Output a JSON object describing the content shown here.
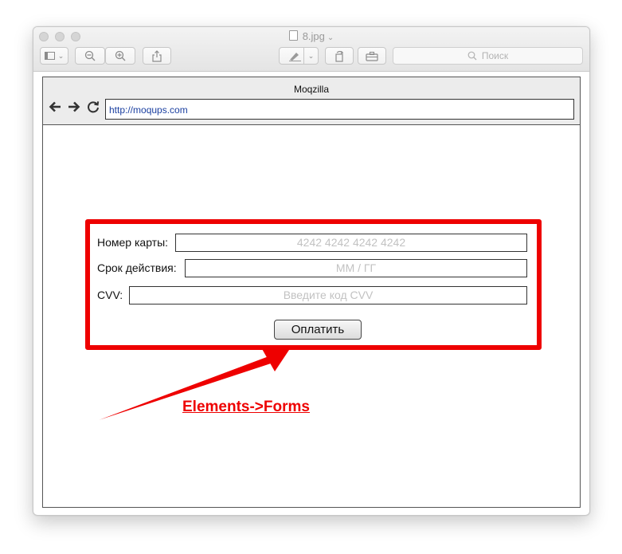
{
  "window": {
    "title": "8.jpg",
    "search_placeholder": "Поиск",
    "colors": {
      "chrome": "#e9e9e9",
      "traffic_light": "#d5d5d5"
    },
    "toolbar_icons": [
      "sidebar-icon",
      "zoom-out-icon",
      "zoom-in-icon",
      "share-icon",
      "markup-icon",
      "rotate-icon",
      "toolbox-icon"
    ]
  },
  "mockup": {
    "browser_title": "Moqzilla",
    "url": "http://moqups.com",
    "nav_icons": [
      "back-arrow-icon",
      "forward-arrow-icon",
      "reload-icon"
    ]
  },
  "form": {
    "card_label": "Номер карты:",
    "card_placeholder": "4242 4242 4242 4242",
    "expiry_label": "Срок действия:",
    "expiry_placeholder": "ММ / ГГ",
    "cvv_label": "CVV:",
    "cvv_placeholder": "Введите код CVV",
    "pay_button": "Оплатить"
  },
  "annotation": {
    "text": "Elements->Forms",
    "color": "#ee0000"
  }
}
